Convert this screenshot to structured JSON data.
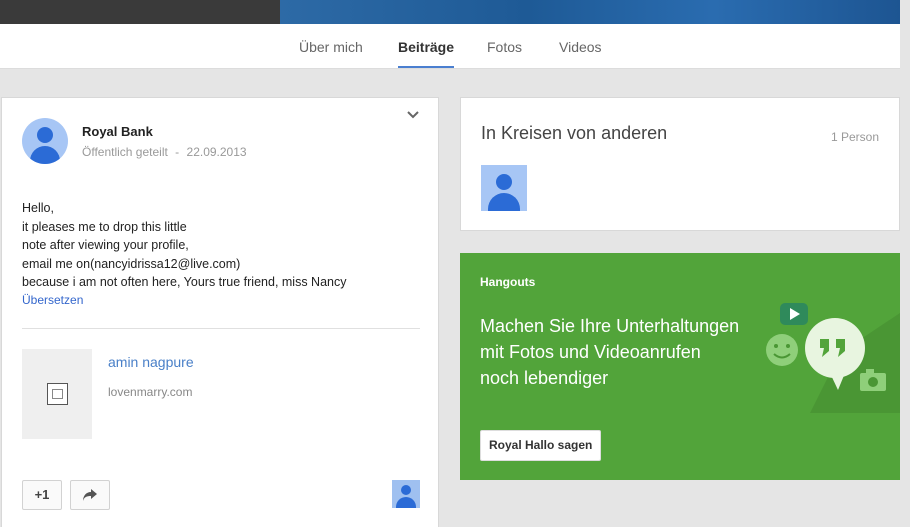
{
  "tabs": [
    {
      "label": "Über mich"
    },
    {
      "label": "Beiträge"
    },
    {
      "label": "Fotos"
    },
    {
      "label": "Videos"
    }
  ],
  "post": {
    "author": "Royal Bank",
    "visibility": "Öffentlich geteilt",
    "separator": "-",
    "date": "22.09.2013",
    "lines": [
      "Hello,",
      "it pleases me to drop this little",
      "note after viewing your profile,",
      "email me on(nancyidrissa12@live.com)",
      "because i am not often here, Yours true friend, miss Nancy"
    ],
    "translate_label": "Übersetzen",
    "link": {
      "title": "amin nagpure",
      "domain": "lovenmarry.com"
    },
    "plus_label": "+1"
  },
  "circles": {
    "title": "In Kreisen von anderen",
    "count": "1 Person"
  },
  "hangouts": {
    "label": "Hangouts",
    "lines": [
      "Machen Sie Ihre Unterhaltungen",
      "mit Fotos und Videoanrufen",
      "noch lebendiger"
    ],
    "button_label": "Royal Hallo sagen"
  },
  "colors": {
    "accent": "#4a7fd0",
    "link": "#3366cc",
    "hangouts_bg": "#52a43a",
    "avatar_blue": "#2b6bd6"
  },
  "icons": [
    "chevron-down-icon",
    "share-arrow-icon",
    "document-icon",
    "hangouts-quote-icon",
    "video-play-icon",
    "smiley-icon",
    "camera-icon"
  ]
}
